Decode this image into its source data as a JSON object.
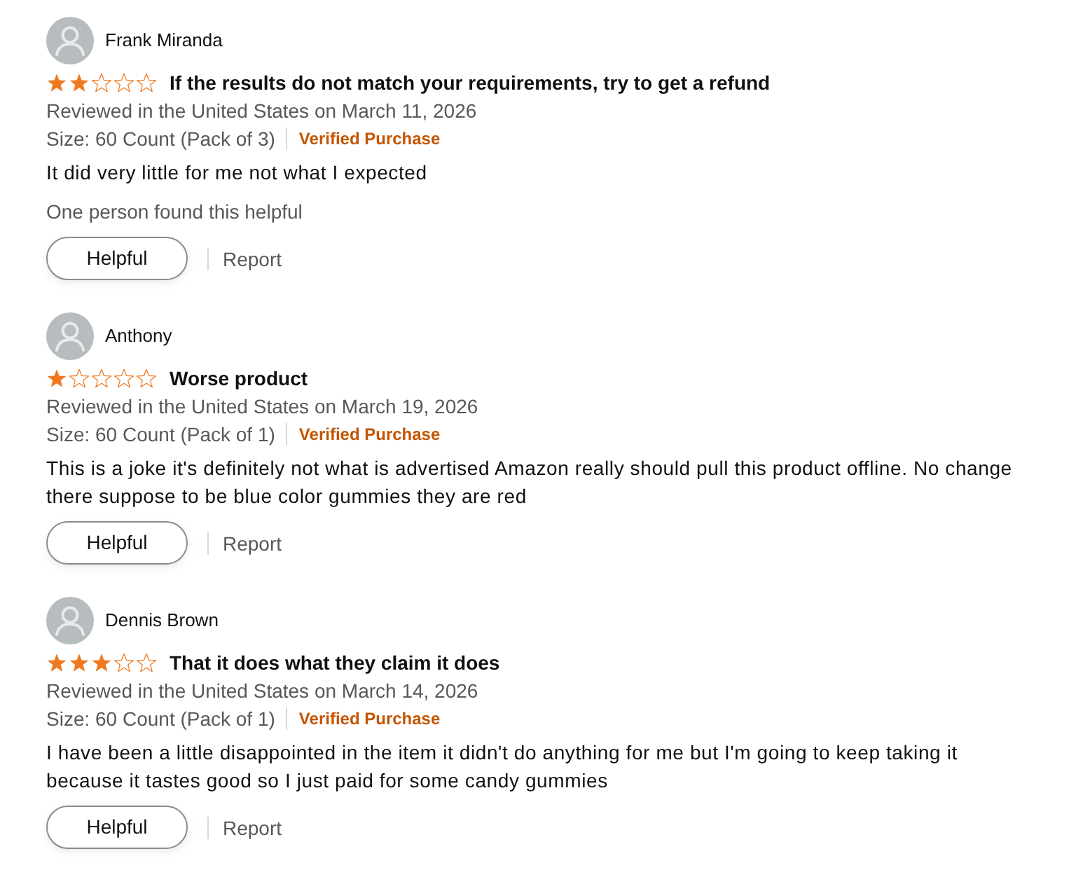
{
  "reviews": [
    {
      "reviewer": "Frank Miranda",
      "stars": 2,
      "title": "If the results do not match your requirements, try to get a refund",
      "reviewed": "Reviewed in the United States on March 11, 2026",
      "size": "Size: 60 Count (Pack of 3)",
      "verified": "Verified Purchase",
      "body": "It did very little for me not what I expected",
      "helpful_count": "One person found this helpful",
      "helpful_button": "Helpful",
      "report": "Report"
    },
    {
      "reviewer": "Anthony",
      "stars": 1,
      "title": "Worse product",
      "reviewed": "Reviewed in the United States on March 19, 2026",
      "size": "Size: 60 Count (Pack of 1)",
      "verified": "Verified Purchase",
      "body": "This is a joke it's definitely not what is advertised Amazon really should pull this product offline. No change there suppose to be blue color gummies they are red",
      "helpful_button": "Helpful",
      "report": "Report"
    },
    {
      "reviewer": "Dennis Brown",
      "stars": 3,
      "title": "That it does what they claim it does",
      "reviewed": "Reviewed in the United States on March 14, 2026",
      "size": "Size: 60 Count (Pack of 1)",
      "verified": "Verified Purchase",
      "body": "I have been a little disappointed in the item it didn't do anything for me but I'm going to keep taking it because it tastes good so I just paid for some candy gummies",
      "helpful_button": "Helpful",
      "report": "Report"
    }
  ]
}
